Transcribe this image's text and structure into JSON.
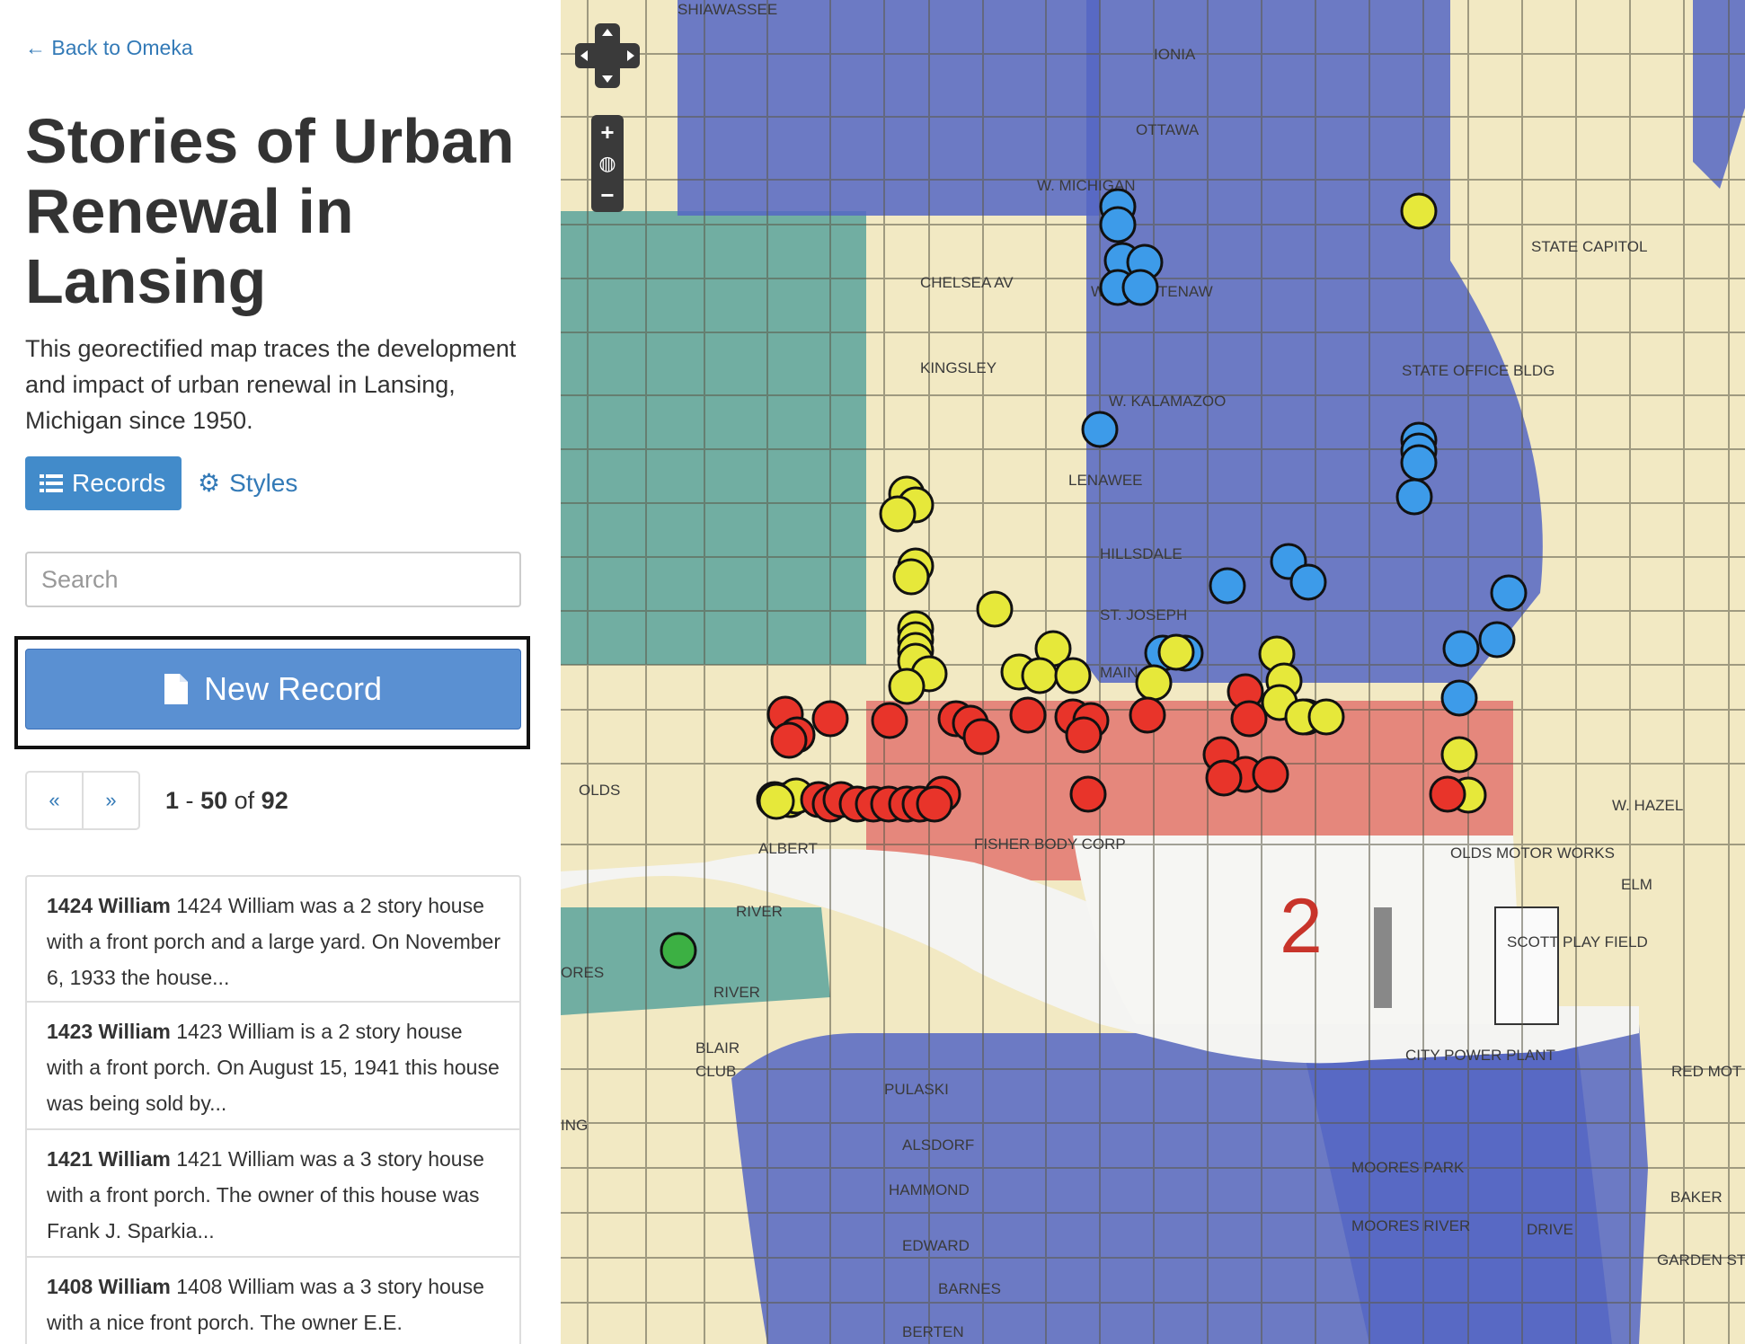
{
  "sidebar": {
    "back_link": "← Back to Omeka",
    "title": "Stories of Urban Renewal in Lansing",
    "description": "This georectified map traces the development and impact of urban renewal in Lansing, Michigan since 1950.",
    "tabs": {
      "records": "Records",
      "styles": "Styles"
    },
    "search": {
      "placeholder": "Search",
      "value": ""
    },
    "new_record_label": "New Record",
    "pager": {
      "prev": "«",
      "next": "»",
      "start": "1",
      "end": "50",
      "total": "92",
      "of": "of",
      "dash": "-"
    },
    "records": [
      {
        "title": "1424 William",
        "snippet": "1424 William was a 2 story house with a front porch and a large yard. On November 6, 1933 the house..."
      },
      {
        "title": "1423 William",
        "snippet": "1423 William is a 2 story house with a front porch. On August 15, 1941 this house was being sold by..."
      },
      {
        "title": "1421 William",
        "snippet": "1421 William was a 3 story house with a front porch. The owner of this house was Frank J. Sparkia..."
      },
      {
        "title": "1408 William",
        "snippet": "1408 William was a 3 story house with a nice front porch. The owner E.E."
      }
    ]
  },
  "map": {
    "labels": [
      "SHIAWASSEE",
      "IONIA",
      "OTTAWA",
      "W. MICHIGAN",
      "CHELSEA AV",
      "KINGSLEY",
      "W. WASHTENAW",
      "W. KALAMAZOO",
      "LENAWEE",
      "HILLSDALE",
      "ST. JOSEPH",
      "MAIN",
      "OLDS",
      "ALBERT",
      "RIVER",
      "RIVER",
      "CLUB",
      "BLAIR",
      "PULASKI",
      "ALSDORF",
      "HAMMOND",
      "EDWARD",
      "BARNES",
      "BERTEN",
      "MOORES PARK",
      "MOORES RIVER",
      "DRIVE",
      "SCOTT PLAY FIELD",
      "CITY POWER PLANT",
      "OLDS MOTOR WORKS",
      "STATE CAPITOL",
      "STATE OFFICE BLDG",
      "W. HAZEL",
      "ELM",
      "BAKER",
      "GARDEN ST",
      "RED MOT",
      "FISHER BODY CORP",
      "ING",
      "ORES"
    ],
    "marker_colors": {
      "red": "#e8342a",
      "yellow": "#e6e83a",
      "blue": "#3d9be9",
      "green": "#3cb043"
    },
    "zones": {
      "blue": "#5566c4",
      "teal": "#5aa39c",
      "yellow": "#f0e59a",
      "red": "#e37670",
      "river": "#f4f4f2"
    },
    "zoom_in": "+",
    "zoom_out": "−"
  }
}
